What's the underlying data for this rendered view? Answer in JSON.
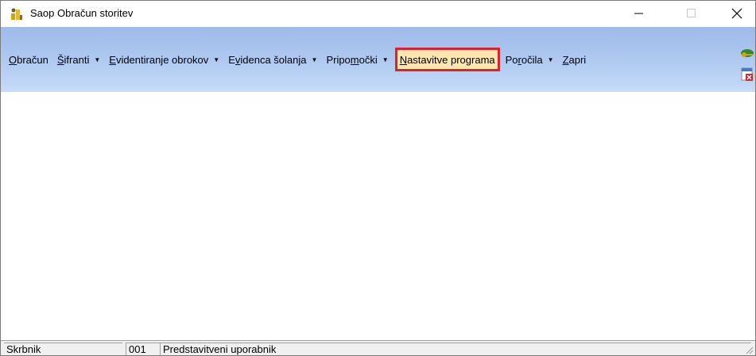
{
  "window": {
    "title": "Saop Obračun storitev",
    "app_icon": "saop-app-icon",
    "controls": {
      "minimize_icon": "minimize-icon",
      "maximize_icon": "maximize-icon",
      "close_icon": "close-icon"
    }
  },
  "menu": {
    "items": [
      {
        "label_ul": "O",
        "label_rest": "bračun",
        "has_dropdown": false
      },
      {
        "label_ul": "Š",
        "label_rest": "ifranti",
        "has_dropdown": true
      },
      {
        "label_ul": "E",
        "label_rest": "videntiranje obrokov",
        "has_dropdown": true
      },
      {
        "label_pre": "E",
        "label_ul": "v",
        "label_rest": "idenca šolanja",
        "has_dropdown": true
      },
      {
        "label_pre": "Pripo",
        "label_ul": "m",
        "label_rest": "očki",
        "has_dropdown": true
      },
      {
        "label_ul": "N",
        "label_rest": "astavitve programa",
        "has_dropdown": false,
        "highlighted": true
      },
      {
        "label_pre": "Po",
        "label_ul": "r",
        "label_rest": "očila",
        "has_dropdown": true
      },
      {
        "label_ul": "Z",
        "label_rest": "apri",
        "has_dropdown": false
      }
    ],
    "dropdown_arrow": "▼",
    "right_icons": [
      "keys-icon",
      "close-window-icon"
    ]
  },
  "statusbar": {
    "user_role": "Skrbnik",
    "user_code": "001",
    "user_name": "Predstavitveni uporabnik"
  },
  "colors": {
    "menubar_gradient_top": "#a6c1ec",
    "menubar_gradient_bottom": "#c7dcf9",
    "highlight_fill": "#fbe6b0",
    "highlight_border": "#e0202a"
  }
}
